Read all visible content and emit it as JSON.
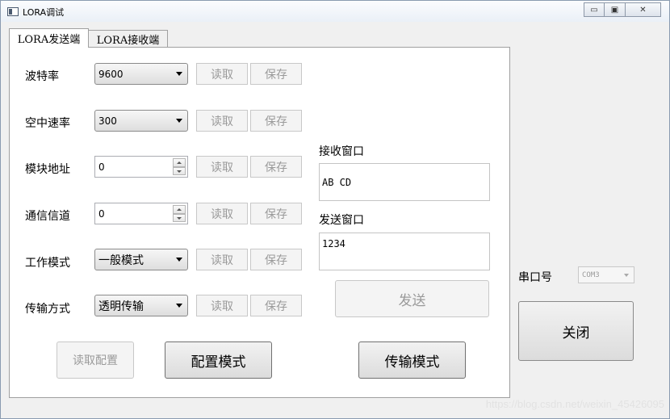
{
  "window": {
    "title": "LORA调试",
    "min_icon": "minimize-icon",
    "max_icon": "maximize-icon",
    "close_icon": "close-icon"
  },
  "tabs": [
    {
      "label": "LORA发送端",
      "active": true
    },
    {
      "label": "LORA接收端",
      "active": false
    }
  ],
  "settings": {
    "read_label": "读取",
    "save_label": "保存",
    "rows": [
      {
        "label": "波特率",
        "control": "combo",
        "value": "9600"
      },
      {
        "label": "空中速率",
        "control": "combo",
        "value": "300"
      },
      {
        "label": "模块地址",
        "control": "spin",
        "value": "0"
      },
      {
        "label": "通信信道",
        "control": "spin",
        "value": "0"
      },
      {
        "label": "工作模式",
        "control": "combo",
        "value": "一般模式"
      },
      {
        "label": "传输方式",
        "control": "combo",
        "value": "透明传输"
      }
    ]
  },
  "receive": {
    "label": "接收窗口",
    "value": "AB CD"
  },
  "send": {
    "label": "发送窗口",
    "value": "1234",
    "button": "发送"
  },
  "bottom": {
    "read_config": "读取配置",
    "config_mode": "配置模式",
    "transfer_mode": "传输模式"
  },
  "serial": {
    "label": "串口号",
    "port": "COM3",
    "toggle": "关闭"
  },
  "watermark": "https://blog.csdn.net/weixin_45426095"
}
